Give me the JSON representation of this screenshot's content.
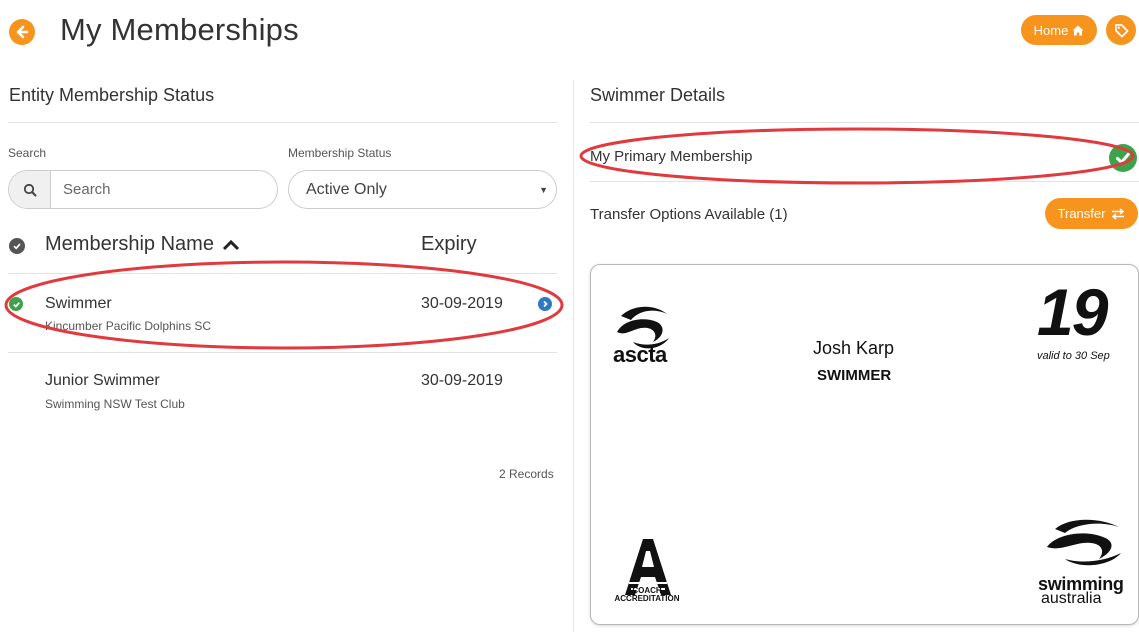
{
  "header": {
    "title": "My Memberships",
    "home_label": "Home"
  },
  "left": {
    "section_title": "Entity Membership Status",
    "search_label": "Search",
    "search_placeholder": "Search",
    "status_label": "Membership Status",
    "status_value": "Active Only",
    "columns": {
      "name": "Membership Name",
      "expiry": "Expiry"
    },
    "rows": [
      {
        "name": "Swimmer",
        "entity": "Kincumber Pacific Dolphins SC",
        "expiry": "30-09-2019"
      },
      {
        "name": "Junior Swimmer",
        "entity": "Swimming NSW Test Club",
        "expiry": "30-09-2019"
      }
    ],
    "records": "2 Records"
  },
  "right": {
    "section_title": "Swimmer Details",
    "primary_label": "My Primary Membership",
    "transfer_label": "Transfer Options Available (1)",
    "transfer_button": "Transfer"
  },
  "card": {
    "org_logo_text": "ascta",
    "member_name": "Josh Karp",
    "member_role": "SWIMMER",
    "year": "19",
    "valid_text": "valid to 30 Sep",
    "coach_text_1": "COACH",
    "coach_text_2": "ACCREDITATION",
    "sa_text_1": "swimming",
    "sa_text_2": "australia"
  },
  "colors": {
    "accent": "#f7941d",
    "success": "#3ca34a",
    "info": "#2f78c4",
    "annotation": "#e0393e"
  }
}
